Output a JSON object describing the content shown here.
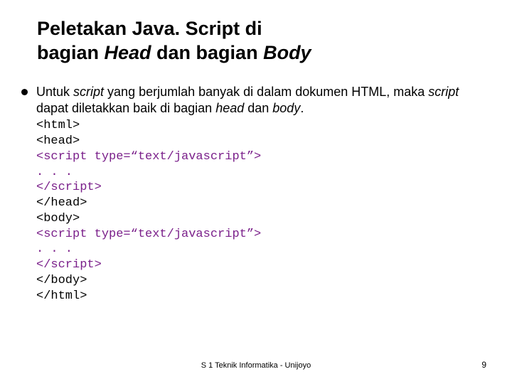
{
  "title": {
    "line1_a": "Peletakan Java. Script di",
    "line2_a": "bagian ",
    "line2_b": "Head",
    "line2_c": " dan bagian ",
    "line2_d": "Body"
  },
  "bullet": {
    "p1": "Untuk ",
    "p2": "script",
    "p3": " yang berjumlah banyak di dalam dokumen HTML, maka ",
    "p4": "script",
    "p5": " dapat diletakkan baik di bagian ",
    "p6": "head",
    "p7": " dan ",
    "p8": "body",
    "p9": "."
  },
  "code": {
    "l1": "<html>",
    "l2": "<head>",
    "l3": "<script type=“text/javascript”>",
    "l4": ". . .",
    "l5": "</scr",
    "l5b": "ipt>",
    "l6": "</head>",
    "l7": "<body>",
    "l8": "<script type=“text/javascript”>",
    "l9": ". . .",
    "l10": "</scr",
    "l10b": "ipt>",
    "l11": "</body>",
    "l12": "</html>"
  },
  "footer": {
    "center": "S 1 Teknik Informatika - Unijoyo",
    "page": "9"
  }
}
